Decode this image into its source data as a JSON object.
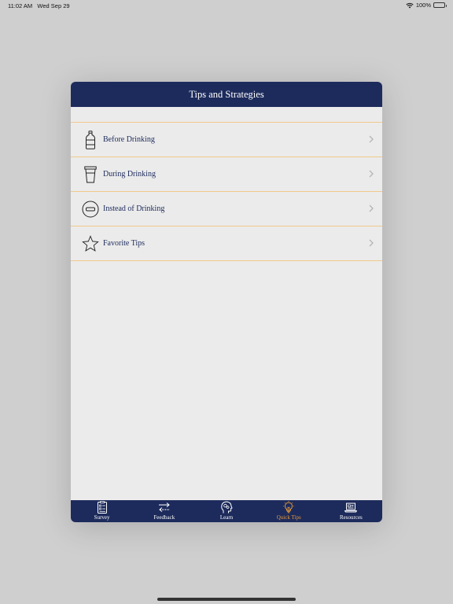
{
  "status": {
    "time": "11:02 AM",
    "date": "Wed Sep 29",
    "battery": "100%"
  },
  "header": {
    "title": "Tips and Strategies"
  },
  "list": {
    "items": [
      {
        "label": "Before Drinking",
        "icon": "water-bottle-icon"
      },
      {
        "label": "During Drinking",
        "icon": "cup-icon"
      },
      {
        "label": "Instead of Drinking",
        "icon": "minus-circle-icon"
      },
      {
        "label": "Favorite Tips",
        "icon": "star-icon"
      }
    ]
  },
  "tabs": [
    {
      "label": "Survey",
      "icon": "clipboard-icon"
    },
    {
      "label": "Feedback",
      "icon": "arrows-exchange-icon"
    },
    {
      "label": "Learn",
      "icon": "head-gears-icon"
    },
    {
      "label": "Quick Tips",
      "icon": "lightbulb-icon",
      "active": true
    },
    {
      "label": "Resources",
      "icon": "laptop-icon"
    }
  ],
  "colors": {
    "navy": "#1d2b5c",
    "accent": "#e69a3b",
    "divider": "#f0c98a",
    "surface": "#ebebeb"
  }
}
